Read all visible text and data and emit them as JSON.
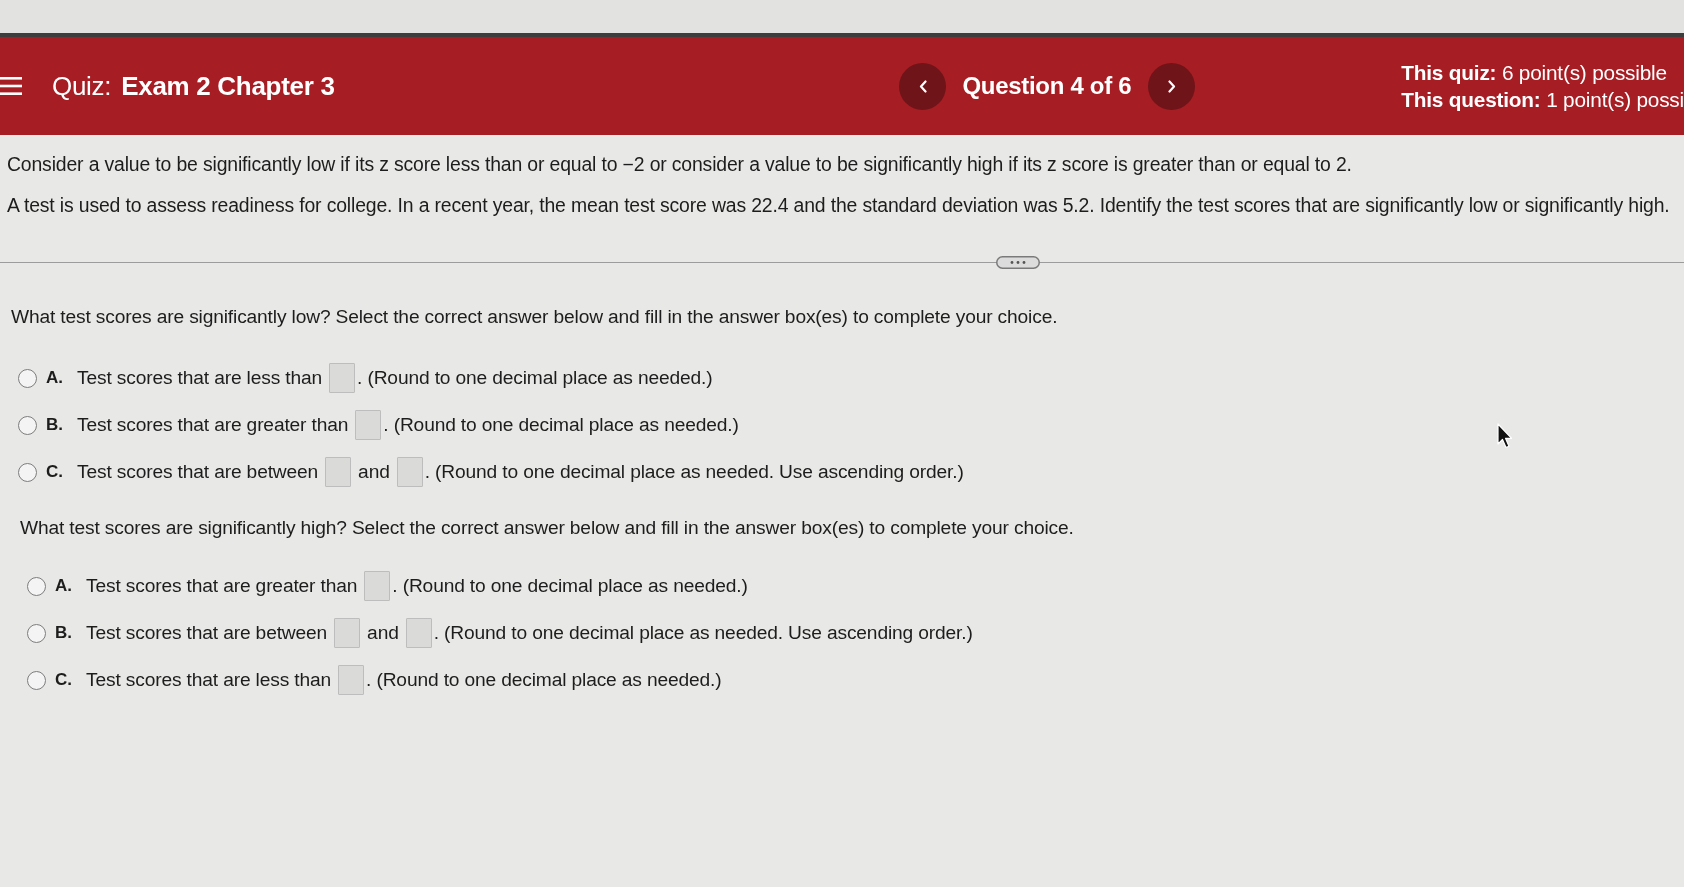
{
  "header": {
    "quiz_label": "Quiz:",
    "quiz_title": "Exam 2 Chapter 3",
    "question_counter": "Question 4 of 6",
    "points": [
      "**This quiz:** 6 point(s) possible",
      "**This question:** 1 point(s) possi"
    ]
  },
  "intro": [
    "Consider a value to be significantly low if its z score less than or equal to −2 or consider a value to be significantly high if its z score is greater than or equal to 2.",
    "A test is used to assess readiness for college. In a recent year, the mean test score was 22.4 and the standard deviation was 5.2. Identify the test scores that are significantly low or significantly high."
  ],
  "parts": [
    {
      "prompt": "What test scores are significantly low? Select the correct answer below and fill in the answer box(es) to complete your choice.",
      "options": [
        {
          "letter": "A.",
          "selected": false,
          "segments": [
            {
              "kind": "text",
              "text": "Test scores that are less than"
            },
            {
              "kind": "blank"
            },
            {
              "kind": "text",
              "text": ". (Round to one decimal place as needed.)"
            }
          ]
        },
        {
          "letter": "B.",
          "selected": false,
          "segments": [
            {
              "kind": "text",
              "text": "Test scores that are greater than"
            },
            {
              "kind": "blank"
            },
            {
              "kind": "text",
              "text": ". (Round to one decimal place as needed.)"
            }
          ]
        },
        {
          "letter": "C.",
          "selected": false,
          "segments": [
            {
              "kind": "text",
              "text": "Test scores that are between"
            },
            {
              "kind": "blank"
            },
            {
              "kind": "text",
              "text": "and"
            },
            {
              "kind": "blank"
            },
            {
              "kind": "text",
              "text": ". (Round to one decimal place as needed. Use ascending order.)"
            }
          ]
        }
      ]
    },
    {
      "prompt": "What test scores are significantly high? Select the correct answer below and fill in the answer box(es) to complete your choice.",
      "options": [
        {
          "letter": "A.",
          "selected": false,
          "segments": [
            {
              "kind": "text",
              "text": "Test scores that are greater than"
            },
            {
              "kind": "blank"
            },
            {
              "kind": "text",
              "text": ". (Round to one decimal place as needed.)"
            }
          ]
        },
        {
          "letter": "B.",
          "selected": false,
          "segments": [
            {
              "kind": "text",
              "text": "Test scores that are between"
            },
            {
              "kind": "blank"
            },
            {
              "kind": "text",
              "text": "and"
            },
            {
              "kind": "blank"
            },
            {
              "kind": "text",
              "text": ". (Round to one decimal place as needed. Use ascending order.)"
            }
          ]
        },
        {
          "letter": "C.",
          "selected": false,
          "segments": [
            {
              "kind": "text",
              "text": "Test scores that are less than"
            },
            {
              "kind": "blank"
            },
            {
              "kind": "text",
              "text": ". (Round to one decimal place as needed.)"
            }
          ]
        }
      ]
    }
  ]
}
